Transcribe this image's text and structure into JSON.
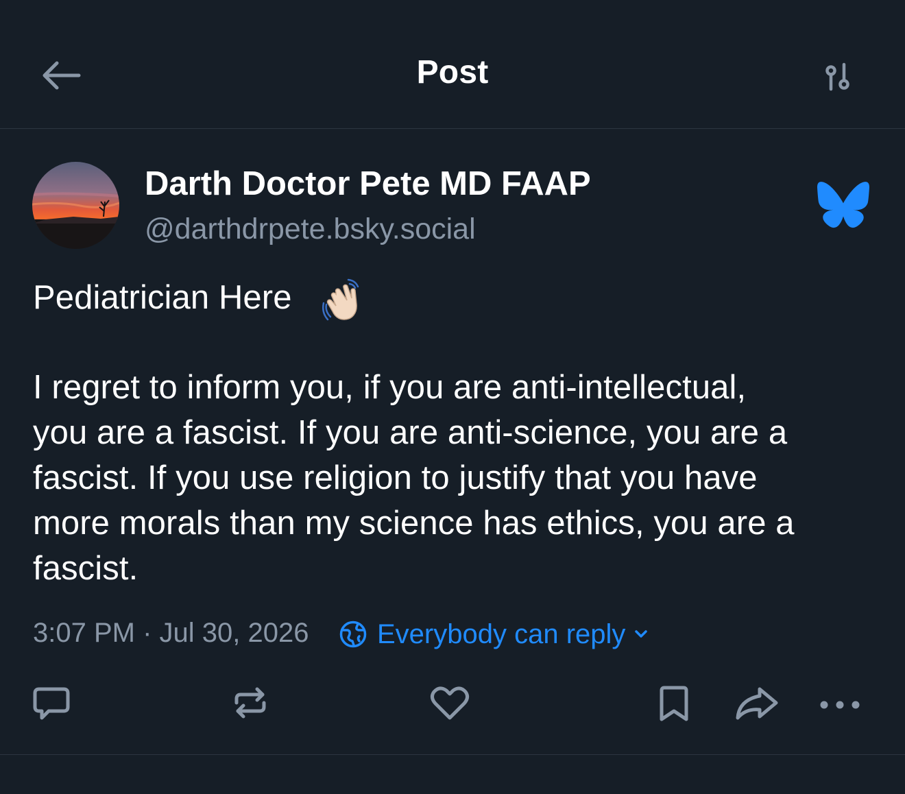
{
  "header": {
    "title": "Post",
    "back_icon": "arrow-left-icon",
    "filter_icon": "sliders-icon"
  },
  "author": {
    "display_name": "Darth Doctor Pete MD FAAP",
    "handle": "@darthdrpete.bsky.social",
    "platform_icon": "bluesky-butterfly-icon"
  },
  "post": {
    "lines": [
      "Pediatrician Here",
      "I regret to inform you, if you are anti-intellectual,",
      "you are a fascist. If you are anti-science, you are a",
      "fascist. If you use religion to justify that you have",
      "more morals than my science has ethics, you are a",
      "fascist."
    ],
    "emoji": "waving-hand-emoji"
  },
  "meta": {
    "timestamp": "3:07 PM · Jul 30, 2026",
    "reply_setting": "Everybody can reply"
  },
  "actions": [
    {
      "name": "reply",
      "icon": "comment-icon"
    },
    {
      "name": "repost",
      "icon": "repost-icon"
    },
    {
      "name": "like",
      "icon": "heart-icon"
    },
    {
      "name": "bookmark",
      "icon": "bookmark-icon"
    },
    {
      "name": "share",
      "icon": "share-icon"
    },
    {
      "name": "more",
      "icon": "more-icon"
    }
  ],
  "colors": {
    "background": "#161e27",
    "text": "#ffffff",
    "muted": "#8a97a7",
    "accent": "#208bfe",
    "divider": "#2c3540"
  }
}
